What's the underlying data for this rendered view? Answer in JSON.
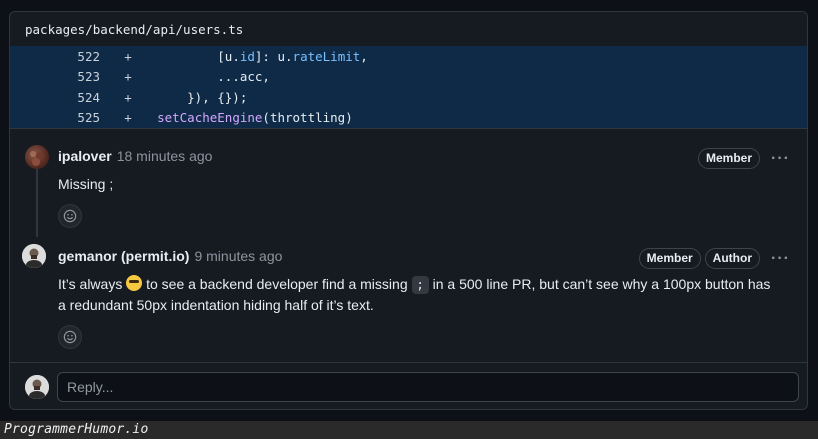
{
  "file": {
    "path": "packages/backend/api/users.ts"
  },
  "code_lines": [
    {
      "num": "522",
      "sign": "+",
      "indent": "          ",
      "parts": [
        {
          "t": "[u.",
          "c": ""
        },
        {
          "t": "id",
          "c": "prop"
        },
        {
          "t": "]: u.",
          "c": ""
        },
        {
          "t": "rateLimit",
          "c": "prop"
        },
        {
          "t": ",",
          "c": ""
        }
      ]
    },
    {
      "num": "523",
      "sign": "+",
      "indent": "          ",
      "parts": [
        {
          "t": "...acc,",
          "c": ""
        }
      ]
    },
    {
      "num": "524",
      "sign": "+",
      "indent": "      ",
      "parts": [
        {
          "t": "}), {});",
          "c": ""
        }
      ]
    },
    {
      "num": "525",
      "sign": "+",
      "indent": "  ",
      "parts": [
        {
          "t": "setCacheEngine",
          "c": "fn"
        },
        {
          "t": "(throttling)",
          "c": ""
        }
      ]
    }
  ],
  "comments": [
    {
      "author": "ipalover",
      "time": "18 minutes ago",
      "badges": [
        "Member"
      ],
      "body": "Missing ;"
    },
    {
      "author": "gemanor (permit.io)",
      "time": "9 minutes ago",
      "badges": [
        "Member",
        "Author"
      ],
      "body_pre": "It’s always ",
      "body_mid": " to see a backend developer find a missing ",
      "body_code": ";",
      "body_post": " in a 500 line PR, but can’t see why a 100px button has a redundant 50px indentation hiding half of it’s text."
    }
  ],
  "icons": {
    "kebab": "kebab-icon",
    "smiley": "smiley-icon"
  },
  "kebab_glyph": "···",
  "reply": {
    "placeholder": "Reply..."
  },
  "watermark": {
    "text": "ProgrammerHumor.io"
  },
  "colors": {
    "diff_added_bg": "#0f2a46",
    "prop": "#79c0ff",
    "fn": "#d2a8ff"
  }
}
